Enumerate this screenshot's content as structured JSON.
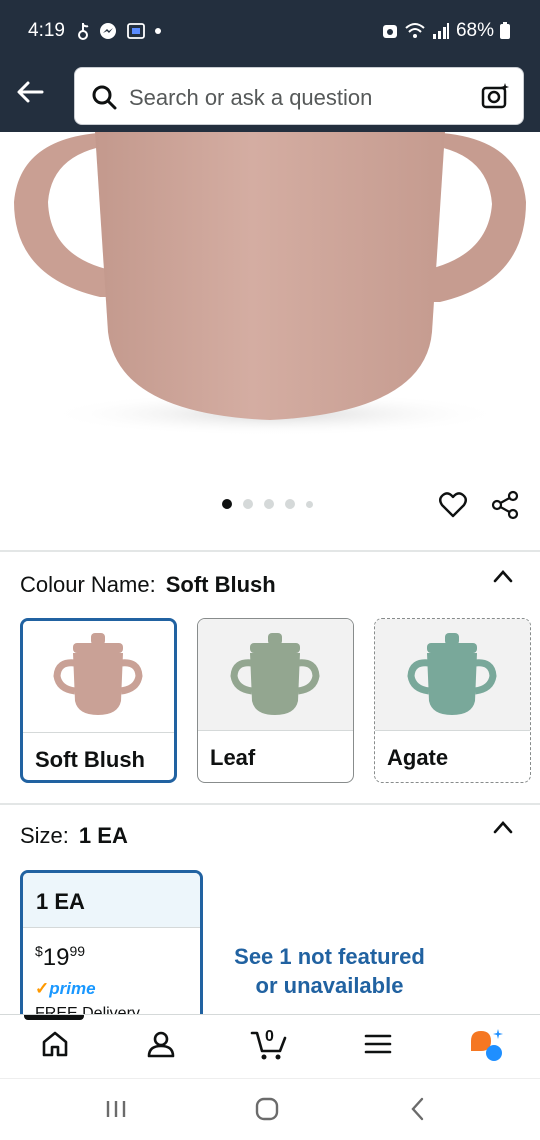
{
  "status_bar": {
    "time": "4:19",
    "battery": "68%"
  },
  "search": {
    "placeholder": "Search or ask a question"
  },
  "product": {
    "image_count": 5,
    "active_image": 1
  },
  "colour": {
    "label": "Colour Name:",
    "selected": "Soft Blush",
    "options": [
      {
        "name": "Soft Blush",
        "color": "#c9a196",
        "state": "selected"
      },
      {
        "name": "Leaf",
        "color": "#93a690",
        "state": "available"
      },
      {
        "name": "Agate",
        "color": "#79a89a",
        "state": "unavailable"
      }
    ]
  },
  "size": {
    "label": "Size:",
    "selected": "1 EA",
    "card": {
      "name": "1 EA",
      "price_symbol": "$",
      "price_whole": "19",
      "price_fraction": "99",
      "prime": "prime",
      "delivery": "FREE Delivery"
    },
    "see_not_featured": "See 1 not featured or unavailable"
  },
  "colors": {
    "header_bg": "#232f3e",
    "accent_blue": "#2162a1",
    "prime_blue": "#1a98ff",
    "mug_pink": "#c9a196"
  },
  "bottom_nav": {
    "items": [
      "home-icon",
      "account-icon",
      "cart-icon",
      "menu-icon",
      "rufus-icon"
    ],
    "cart_count": "0"
  }
}
